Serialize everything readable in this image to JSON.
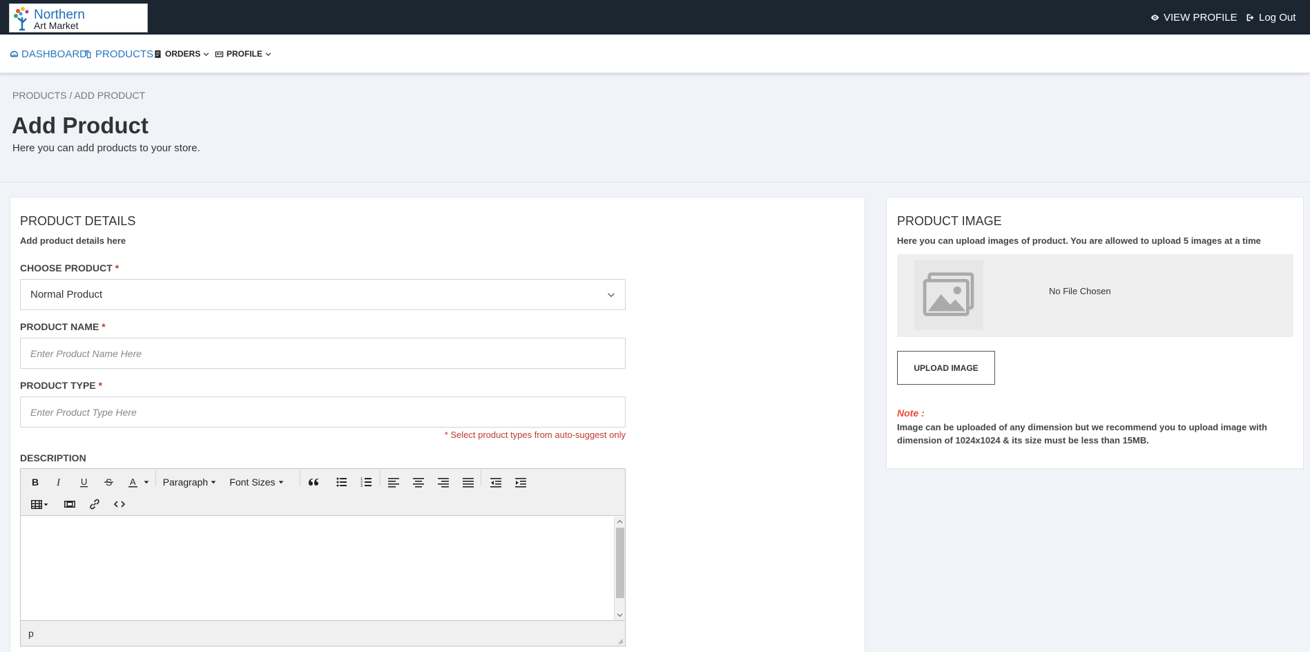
{
  "header": {
    "logo_line1": "Northern",
    "logo_line2": "Art Market",
    "view_profile": "VIEW PROFILE",
    "logout": "Log Out"
  },
  "nav": {
    "dashboard": "DASHBOARD",
    "products": "PRODUCTS",
    "orders": "ORDERS",
    "profile": "PROFILE"
  },
  "page": {
    "breadcrumb": "PRODUCTS / ADD PRODUCT",
    "title": "Add Product",
    "subtitle": "Here you can add products to your store."
  },
  "details": {
    "title": "PRODUCT DETAILS",
    "subtitle": "Add product details here",
    "choose_label": "CHOOSE PRODUCT",
    "required_mark": "*",
    "choose_value": "Normal Product",
    "name_label": "PRODUCT NAME",
    "name_placeholder": "Enter Product Name Here",
    "type_label": "PRODUCT TYPE",
    "type_placeholder": "Enter Product Type Here",
    "type_hint": "* Select product types from auto-suggest only",
    "description_label": "DESCRIPTION"
  },
  "editor": {
    "paragraph": "Paragraph",
    "font_sizes": "Font Sizes",
    "status_path": "p"
  },
  "image": {
    "title": "PRODUCT IMAGE",
    "subtitle": "Here you can upload images of product. You are allowed to upload 5 images at a time",
    "no_file": "No File Chosen",
    "upload_button": "UPLOAD IMAGE",
    "note_label": "Note :",
    "note_text": "Image can be uploaded of any dimension but we recommend you to upload image with dimension of 1024x1024 & its size must be less than 15MB."
  },
  "colors": {
    "topbar": "#1b2631",
    "link": "#2a77c0",
    "required": "#c0392b",
    "note": "#e74c3c"
  }
}
